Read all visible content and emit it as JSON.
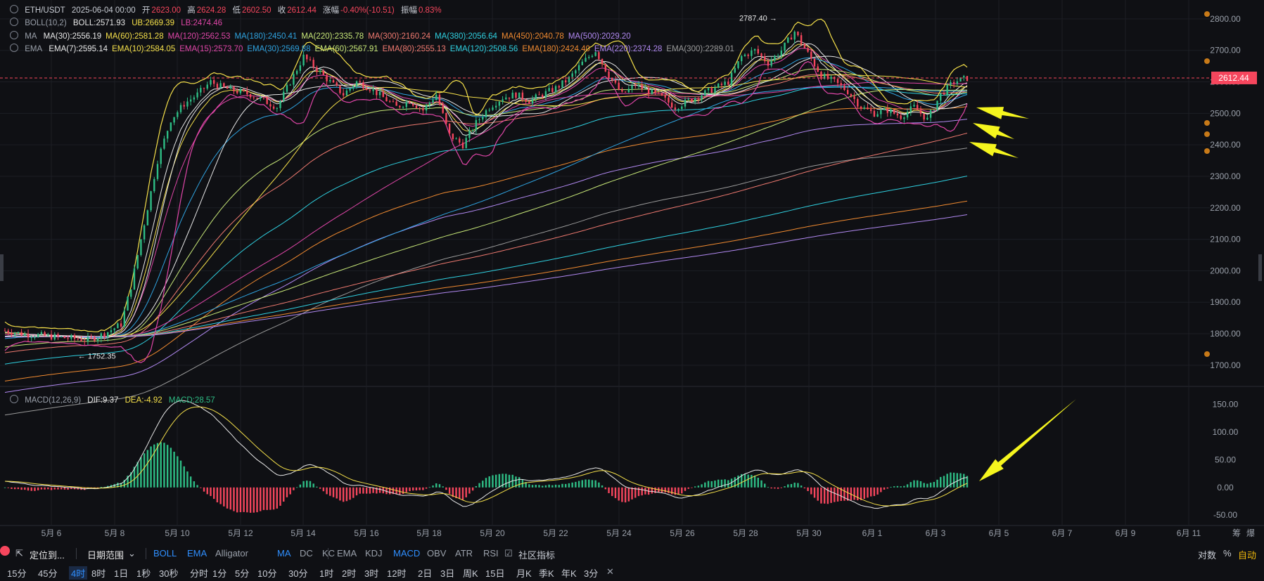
{
  "header": {
    "symbol": "ETH/USDT",
    "datetime": "2025-06-04 00:00",
    "open_label": "开",
    "open": "2623.00",
    "high_label": "高",
    "high": "2624.28",
    "low_label": "低",
    "low": "2602.50",
    "close_label": "收",
    "close": "2612.44",
    "change_label": "涨幅",
    "change": "-0.40%(-10.51)",
    "amp_label": "振幅",
    "amp": "0.83%"
  },
  "boll": {
    "name": "BOLL(10,2)",
    "boll": "BOLL:2571.93",
    "ub": "UB:2669.39",
    "lb": "LB:2474.46"
  },
  "ma": {
    "name": "MA",
    "items": [
      {
        "t": "MA(30):2556.19",
        "c": "#e8e8e8"
      },
      {
        "t": "MA(60):2581.28",
        "c": "#f5e04a"
      },
      {
        "t": "MA(120):2562.53",
        "c": "#e046a8"
      },
      {
        "t": "MA(180):2450.41",
        "c": "#2fa3e0"
      },
      {
        "t": "MA(220):2335.78",
        "c": "#c8e878"
      },
      {
        "t": "MA(300):2160.24",
        "c": "#f07a70"
      },
      {
        "t": "MA(380):2056.64",
        "c": "#2fd0e0"
      },
      {
        "t": "MA(450):2040.78",
        "c": "#f08a30"
      },
      {
        "t": "MA(500):2029.20",
        "c": "#b088f0"
      }
    ]
  },
  "ema": {
    "name": "EMA",
    "items": [
      {
        "t": "EMA(7):2595.14",
        "c": "#e8e8e8"
      },
      {
        "t": "EMA(10):2584.05",
        "c": "#f5e04a"
      },
      {
        "t": "EMA(15):2573.70",
        "c": "#e046a8"
      },
      {
        "t": "EMA(30):2569.88",
        "c": "#2fa3e0"
      },
      {
        "t": "EMA(60):2567.91",
        "c": "#c8e878"
      },
      {
        "t": "EMA(80):2555.13",
        "c": "#f07a70"
      },
      {
        "t": "EMA(120):2508.56",
        "c": "#2fd0e0"
      },
      {
        "t": "EMA(180):2424.40",
        "c": "#f08a30"
      },
      {
        "t": "EMA(220):2374.28",
        "c": "#b088f0"
      },
      {
        "t": "EMA(300):2289.01",
        "c": "#9a9a9a"
      }
    ]
  },
  "macd": {
    "name": "MACD(12,26,9)",
    "dif": "DIF:9.37",
    "dea": "DEA:-4.92",
    "macd": "MACD:28.57"
  },
  "annotations": {
    "high": "2787.40",
    "low": "1752.35",
    "last_price": "2612.44"
  },
  "colors": {
    "up": "#2ebd85",
    "down": "#f6465d",
    "bg": "#0f1014",
    "grid": "#1e2026",
    "arrow": "#f5f51e"
  },
  "toolbar": {
    "locate": "定位到...",
    "range": "日期范围",
    "main_indicators": [
      "BOLL",
      "EMA",
      "Alligator",
      "MA",
      "DC",
      "KC"
    ],
    "sub_indicators": [
      "EMA",
      "KDJ",
      "MACD",
      "OBV",
      "ATR",
      "RSI"
    ],
    "community": "社区指标",
    "log": "对数",
    "pct": "%",
    "auto": "自动",
    "intervals": [
      "15分",
      "45分",
      "4时",
      "8时",
      "1日",
      "1秒",
      "30秒",
      "分时",
      "1分",
      "5分",
      "10分",
      "30分",
      "1时",
      "2时",
      "3时",
      "12时",
      "2日",
      "3日",
      "周K",
      "15日",
      "月K",
      "季K",
      "年K",
      "3分"
    ],
    "active_interval": "4时",
    "close": "✕",
    "corner": [
      "筹",
      "爆"
    ]
  },
  "chart_data": {
    "type": "candlestick",
    "symbol": "ETH/USDT",
    "interval": "4时",
    "x_tick_labels": [
      "5月 6",
      "5月 8",
      "5月 10",
      "5月 12",
      "5月 14",
      "5月 16",
      "5月 18",
      "5月 20",
      "5月 22",
      "5月 24",
      "5月 26",
      "5月 28",
      "5月 30",
      "6月 1",
      "6月 3",
      "6月 5",
      "6月 7",
      "6月 9",
      "6月 11"
    ],
    "price_axis": {
      "ticks": [
        1700,
        1800,
        1900,
        2000,
        2100,
        2200,
        2300,
        2400,
        2500,
        2600,
        2700,
        2800
      ],
      "range": [
        1655,
        2860
      ]
    },
    "macd_axis": {
      "ticks": [
        -50,
        0,
        50,
        100,
        150
      ],
      "range": [
        -65,
        170
      ]
    },
    "price_anchors": [
      [
        0,
        1810
      ],
      [
        5,
        1800
      ],
      [
        10,
        1795
      ],
      [
        15,
        1790
      ],
      [
        20,
        1785
      ],
      [
        25,
        1780
      ],
      [
        30,
        1800
      ],
      [
        35,
        1830
      ],
      [
        38,
        1950
      ],
      [
        42,
        2150
      ],
      [
        46,
        2350
      ],
      [
        50,
        2480
      ],
      [
        54,
        2530
      ],
      [
        58,
        2560
      ],
      [
        62,
        2600
      ],
      [
        66,
        2580
      ],
      [
        70,
        2570
      ],
      [
        74,
        2560
      ],
      [
        78,
        2540
      ],
      [
        82,
        2520
      ],
      [
        86,
        2600
      ],
      [
        90,
        2680
      ],
      [
        94,
        2640
      ],
      [
        98,
        2600
      ],
      [
        102,
        2560
      ],
      [
        106,
        2600
      ],
      [
        110,
        2580
      ],
      [
        114,
        2550
      ],
      [
        118,
        2520
      ],
      [
        122,
        2540
      ],
      [
        126,
        2510
      ],
      [
        130,
        2560
      ],
      [
        134,
        2430
      ],
      [
        138,
        2400
      ],
      [
        142,
        2470
      ],
      [
        146,
        2520
      ],
      [
        150,
        2550
      ],
      [
        154,
        2560
      ],
      [
        158,
        2540
      ],
      [
        162,
        2560
      ],
      [
        166,
        2580
      ],
      [
        170,
        2610
      ],
      [
        174,
        2660
      ],
      [
        178,
        2700
      ],
      [
        182,
        2620
      ],
      [
        186,
        2560
      ],
      [
        190,
        2590
      ],
      [
        194,
        2570
      ],
      [
        198,
        2550
      ],
      [
        202,
        2520
      ],
      [
        206,
        2540
      ],
      [
        210,
        2560
      ],
      [
        214,
        2580
      ],
      [
        218,
        2600
      ],
      [
        222,
        2680
      ],
      [
        226,
        2700
      ],
      [
        230,
        2660
      ],
      [
        234,
        2700
      ],
      [
        238,
        2760
      ],
      [
        242,
        2690
      ],
      [
        246,
        2620
      ],
      [
        250,
        2600
      ],
      [
        254,
        2570
      ],
      [
        258,
        2520
      ],
      [
        262,
        2500
      ],
      [
        266,
        2510
      ],
      [
        270,
        2490
      ],
      [
        274,
        2520
      ],
      [
        278,
        2480
      ],
      [
        282,
        2560
      ],
      [
        286,
        2600
      ],
      [
        290,
        2612
      ]
    ],
    "annotations": {
      "high": 2787.4,
      "low": 1752.35,
      "last": 2612.44
    }
  }
}
